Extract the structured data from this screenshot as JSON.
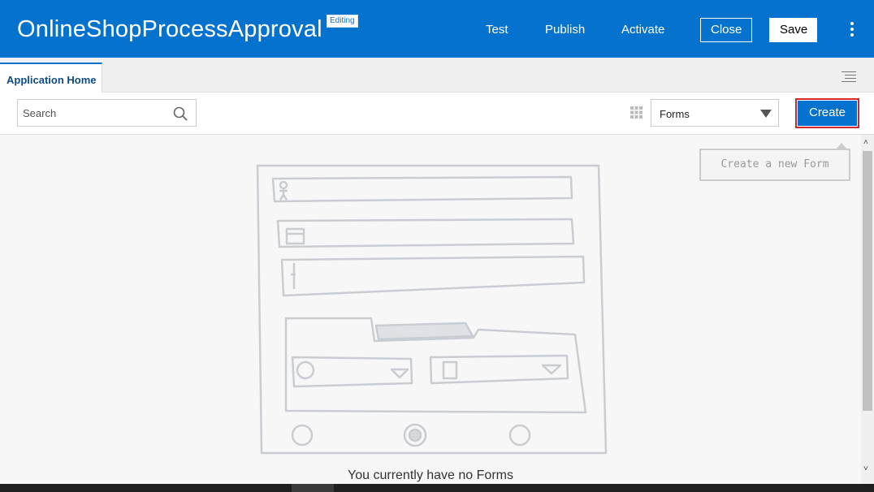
{
  "header": {
    "title": "OnlineShopProcessApproval",
    "badge": "Editing",
    "links": {
      "test": "Test",
      "publish": "Publish",
      "activate": "Activate"
    },
    "buttons": {
      "close": "Close",
      "save": "Save"
    },
    "brand_color": "#0572ce"
  },
  "tabs": [
    {
      "label": "Application Home"
    }
  ],
  "toolbar": {
    "search_placeholder": "Search",
    "filter_selected": "Forms",
    "create_label": "Create"
  },
  "main": {
    "tooltip": "Create a new Form",
    "empty_message": "You currently have no Forms"
  },
  "icons": [
    "search-icon",
    "grid-icon",
    "chevron-down-icon",
    "kebab-menu-icon",
    "hamburger-menu-icon"
  ]
}
